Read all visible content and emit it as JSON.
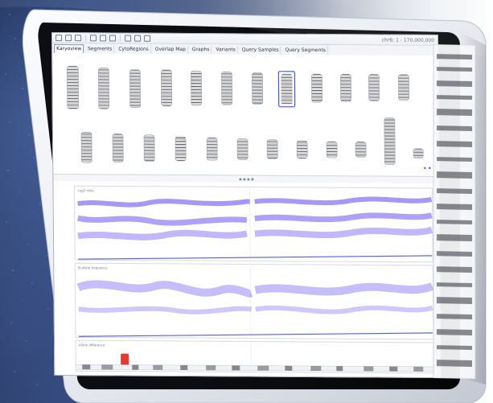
{
  "app": {
    "status_text": "chr6: 1 - 170,000,000"
  },
  "tabs": [
    {
      "label": "Karyoview",
      "active": true
    },
    {
      "label": "Segments",
      "active": false
    },
    {
      "label": "CytoRegions",
      "active": false
    },
    {
      "label": "Overlap Map",
      "active": false
    },
    {
      "label": "Graphs",
      "active": false
    },
    {
      "label": "Variants",
      "active": false
    },
    {
      "label": "Query Samples",
      "active": false
    },
    {
      "label": "Query Segments",
      "active": false
    }
  ],
  "colors": {
    "accent": "#2d4cff",
    "plot_points": "#4a2ff0",
    "plot_points_alt": "#6c4cf5",
    "frame_silver": "#e7e9ed",
    "bezel_dark": "#0b0c10",
    "highlight": "#e23b30"
  },
  "plot": {
    "tracks": [
      "Log2 ratio",
      "B-allele frequency",
      "Allele difference"
    ]
  }
}
